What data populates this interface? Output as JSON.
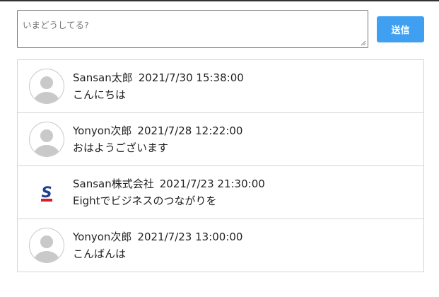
{
  "composer": {
    "placeholder": "いまどうしてる?",
    "value": ""
  },
  "send_button": {
    "label": "送信",
    "color": "#3fa0f2"
  },
  "posts": [
    {
      "author": "Sansan太郎",
      "timestamp": "2021/7/30 15:38:00",
      "message": "こんにちは",
      "avatar": "default-user-icon"
    },
    {
      "author": "Yonyon次郎",
      "timestamp": "2021/7/28 12:22:00",
      "message": "おはようございます",
      "avatar": "default-user-icon"
    },
    {
      "author": "Sansan株式会社",
      "timestamp": "2021/7/23 21:30:00",
      "message": "Eightでビジネスのつながりを",
      "avatar": "sansan-logo-icon"
    },
    {
      "author": "Yonyon次郎",
      "timestamp": "2021/7/23 13:00:00",
      "message": "こんばんは",
      "avatar": "default-user-icon"
    }
  ]
}
